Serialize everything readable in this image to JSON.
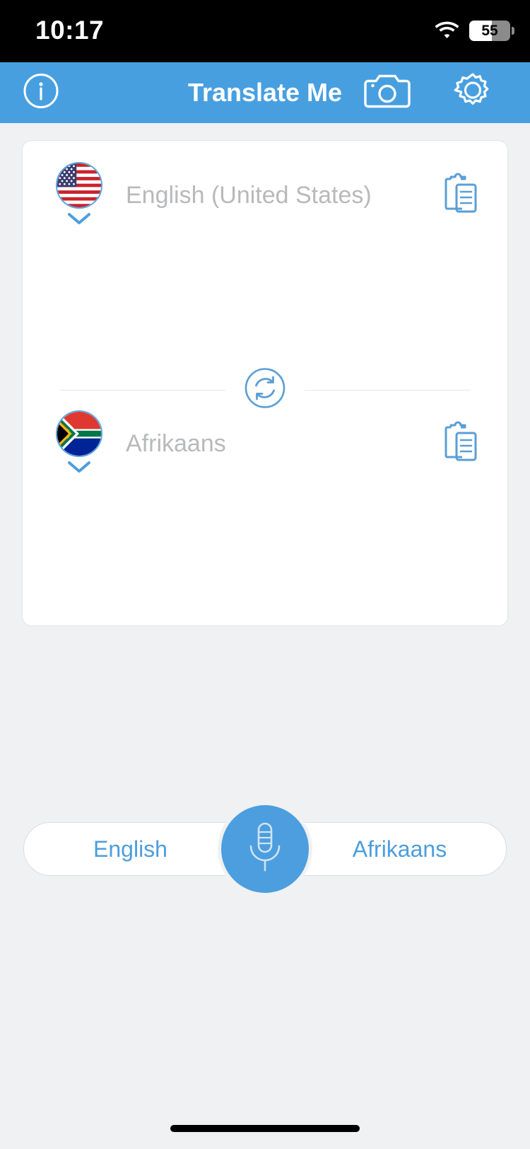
{
  "status_bar": {
    "time": "10:17",
    "wifi_icon": "wifi-icon",
    "battery_percent": "55",
    "battery_level": 55
  },
  "header": {
    "title": "Translate Me",
    "info_icon": "info-circle-icon",
    "camera_icon": "camera-icon",
    "settings_icon": "gear-icon",
    "background_color": "#479FE0"
  },
  "card": {
    "source": {
      "flag_icon": "flag-united-states-icon",
      "language": "English (United States)",
      "dropdown_icon": "chevron-down-icon",
      "copy_icon": "clipboard-copy-icon"
    },
    "target": {
      "flag_icon": "flag-south-africa-icon",
      "language": "Afrikaans",
      "dropdown_icon": "chevron-down-icon",
      "copy_icon": "clipboard-copy-icon"
    },
    "swap_icon": "swap-languages-icon"
  },
  "bottom_bar": {
    "left_label": "English",
    "right_label": "Afrikaans",
    "mic_icon": "microphone-icon",
    "accent_color": "#4C9EDE"
  }
}
